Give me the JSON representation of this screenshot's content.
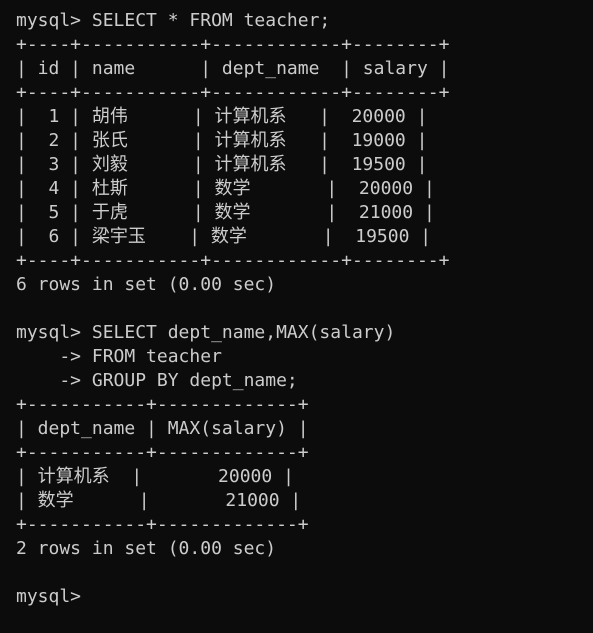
{
  "terminal": {
    "lines": [
      "mysql> SELECT * FROM teacher;",
      "+----+-----------+------------+--------+",
      "| id | name      | dept_name  | salary |",
      "+----+-----------+------------+--------+",
      "|  1 | 胡伟      | 计算机系   |  20000 |",
      "|  2 | 张氏      | 计算机系   |  19000 |",
      "|  3 | 刘毅      | 计算机系   |  19500 |",
      "|  4 | 杜斯      | 数学       |  20000 |",
      "|  5 | 于虎      | 数学       |  21000 |",
      "|  6 | 梁宇玉    | 数学       |  19500 |",
      "+----+-----------+------------+--------+",
      "6 rows in set (0.00 sec)",
      "",
      "mysql> SELECT dept_name,MAX(salary)",
      "    -> FROM teacher",
      "    -> GROUP BY dept_name;",
      "+-----------+-------------+",
      "| dept_name | MAX(salary) |",
      "+-----------+-------------+",
      "| 计算机系  |       20000 |",
      "| 数学      |       21000 |",
      "+-----------+-------------+",
      "2 rows in set (0.00 sec)",
      "",
      "mysql>"
    ]
  }
}
